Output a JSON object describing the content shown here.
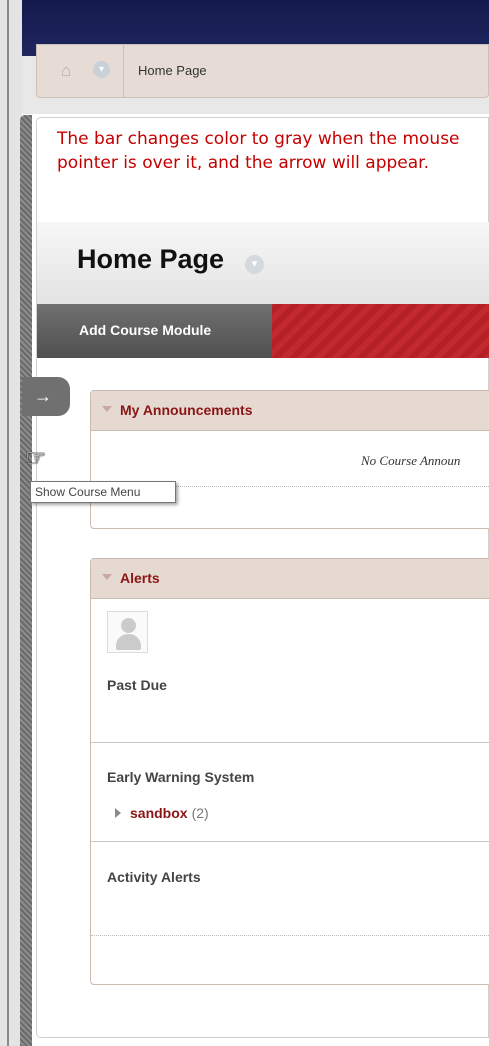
{
  "breadcrumb": {
    "current": "Home Page"
  },
  "annotation": "The bar changes color to gray when the mouse pointer is over it, and the arrow will appear.",
  "page": {
    "title": "Home Page"
  },
  "module_bar": {
    "add_label": "Add Course Module"
  },
  "course_menu": {
    "arrow": "→",
    "tooltip": "Show Course Menu"
  },
  "announcements": {
    "title": "My Announcements",
    "empty_text": "No Course Announ"
  },
  "alerts": {
    "title": "Alerts",
    "sections": {
      "past_due": "Past Due",
      "early_warning": "Early Warning System",
      "activity": "Activity Alerts"
    },
    "course": {
      "name": "sandbox",
      "count": "(2)"
    }
  },
  "colors": {
    "topbar": "#1a2056",
    "breadcrumb_bg": "#e6dcd5",
    "annotation": "#c40000",
    "module_bar": "#b32126",
    "module_title": "#8b1515"
  },
  "icons": {
    "home": "home-icon",
    "chevron": "chevron-down-icon",
    "arrow": "arrow-right-icon",
    "cursor": "hand-pointer-icon",
    "avatar": "user-avatar-icon"
  }
}
